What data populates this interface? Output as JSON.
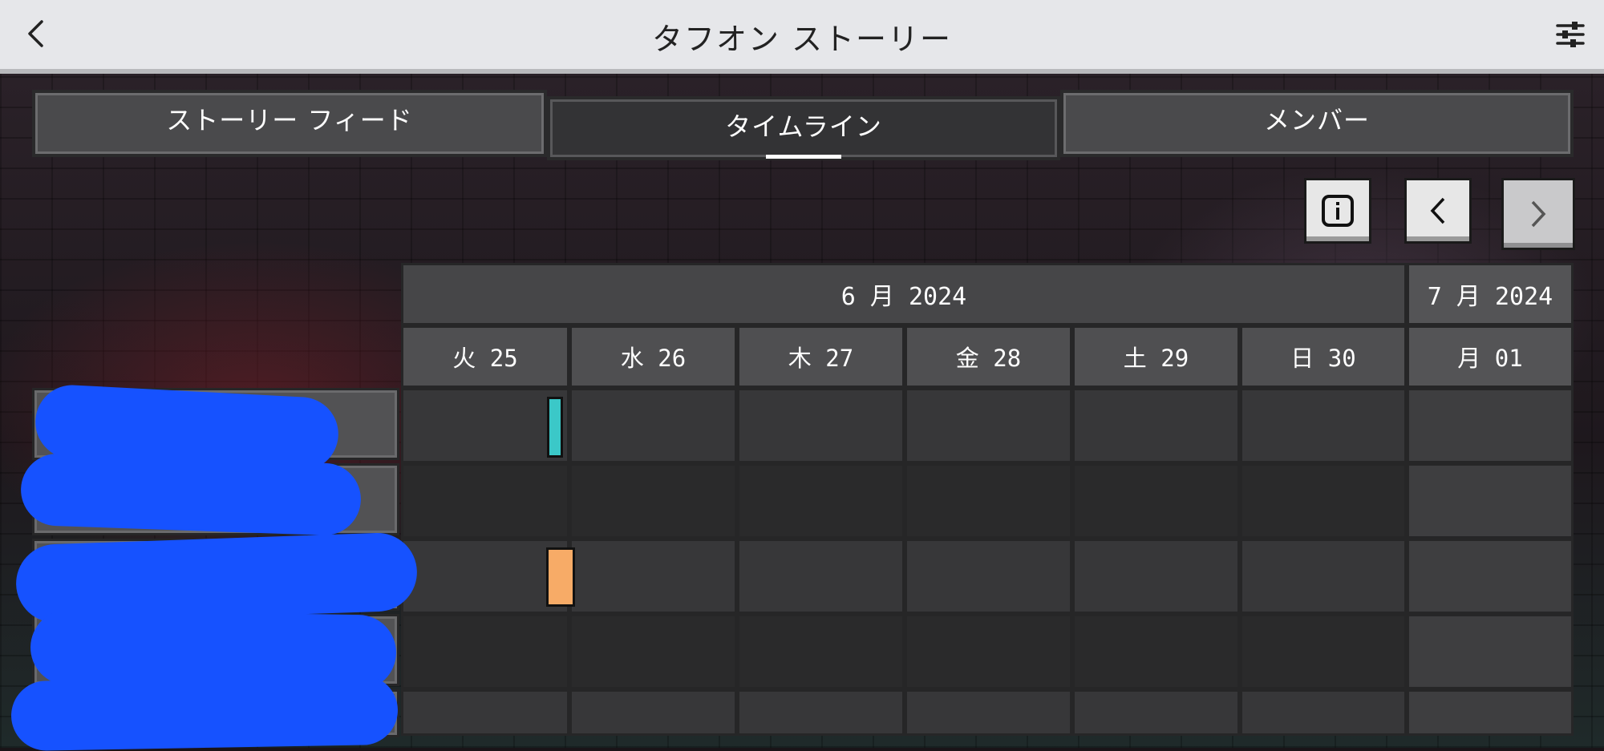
{
  "header": {
    "title": "タフオン ストーリー",
    "back_icon": "chevron-left-icon",
    "settings_icon": "sliders-icon"
  },
  "tabs": [
    {
      "label": "ストーリー フィード",
      "active": false
    },
    {
      "label": "タイムライン",
      "active": true
    },
    {
      "label": "メンバー",
      "active": false
    }
  ],
  "controls": {
    "info_icon": "info-icon",
    "prev_icon": "chevron-left-icon",
    "next_icon": "chevron-right-icon"
  },
  "timeline": {
    "months": [
      {
        "label": "6 月 2024"
      },
      {
        "label": "7 月 2024"
      }
    ],
    "days": [
      {
        "label": "火 25"
      },
      {
        "label": "水 26"
      },
      {
        "label": "木 27"
      },
      {
        "label": "金 28"
      },
      {
        "label": "土 29"
      },
      {
        "label": "日 30"
      },
      {
        "label": "月 01"
      }
    ],
    "markers": [
      {
        "color": "#3bc8c8"
      },
      {
        "color": "#f7ab67"
      }
    ]
  },
  "colors": {
    "redaction": "#1652ff",
    "header_bg": "#e6e7ea"
  }
}
